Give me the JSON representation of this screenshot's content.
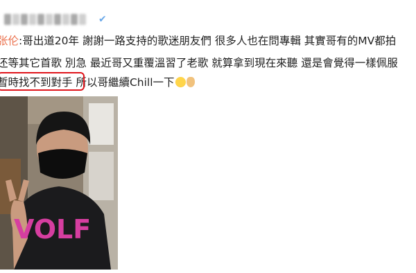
{
  "post": {
    "author_name": "张伦",
    "line1_text": ":哥出道20年 謝謝一路支持的歌迷朋友們 很多人也在問專輯 其實哥有的MV都拍",
    "line2_text": "还等其它首歌 別急 最近哥又重覆溫習了老歌 就算拿到現在來聽 還是會覺得一樣佩服",
    "line3_highlighted": "暫時找不到對手",
    "line3_rest": " 所以哥繼續Chill一下",
    "emojis": [
      "laugh-emoji",
      "peace-hand-emoji"
    ],
    "photo_shirt_text": "VOLF"
  },
  "colors": {
    "author_name": "#eb7350",
    "highlight_border": "#e0141b",
    "shirt_text": "#d63ea0"
  }
}
